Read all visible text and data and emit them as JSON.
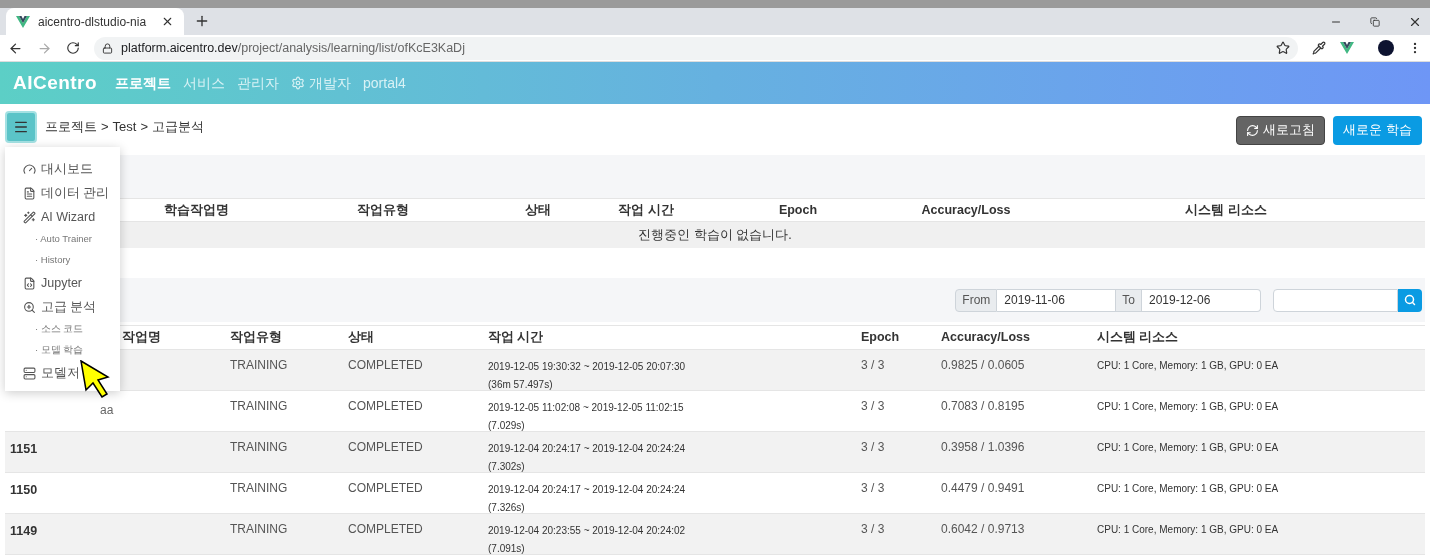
{
  "browser": {
    "tab_title": "aicentro-dlstudio-nia",
    "url_host": "platform.aicentro.dev",
    "url_path": "/project/analysis/learning/list/ofKcE3KaDj"
  },
  "navbar": {
    "brand": "AICentro",
    "items": [
      {
        "label": "프로젝트",
        "selected": true,
        "has_icon": false
      },
      {
        "label": "서비스",
        "selected": false,
        "has_icon": false
      },
      {
        "label": "관리자",
        "selected": false,
        "has_icon": false
      },
      {
        "label": "개발자",
        "selected": false,
        "has_icon": true
      },
      {
        "label": "portal4",
        "selected": false,
        "has_icon": false
      }
    ]
  },
  "breadcrumb": [
    "프로젝트",
    ">",
    "Test",
    ">",
    "고급분석"
  ],
  "buttons": {
    "refresh": "새로고침",
    "new_training": "새로운 학습"
  },
  "side_menu": [
    {
      "label": "대시보드",
      "kind": "main"
    },
    {
      "label": "데이터 관리",
      "kind": "main"
    },
    {
      "label": "AI Wizard",
      "kind": "main"
    },
    {
      "label": "· Auto Trainer",
      "kind": "sub"
    },
    {
      "label": "· History",
      "kind": "sub"
    },
    {
      "label": "Jupyter",
      "kind": "main"
    },
    {
      "label": "고급 분석",
      "kind": "main"
    },
    {
      "label": "· 소스 코드",
      "kind": "sub"
    },
    {
      "label": "· 모델 학습",
      "kind": "sub"
    },
    {
      "label": "모델저",
      "kind": "main"
    }
  ],
  "running_table": {
    "columns": [
      "학습작업명",
      "작업유형",
      "상태",
      "작업 시간",
      "Epoch",
      "Accuracy/Loss",
      "시스템 리소스"
    ],
    "empty_message": "진행중인 학습이 없습니다."
  },
  "filter": {
    "from_label": "From",
    "from_value": "2019-11-06",
    "to_label": "To",
    "to_value": "2019-12-06"
  },
  "history_table": {
    "columns": [
      "작업명",
      "작업유형",
      "상태",
      "작업 시간",
      "Epoch",
      "Accuracy/Loss",
      "시스템 리소스"
    ],
    "rows": [
      {
        "type": "TRAINING",
        "status": "COMPLETED",
        "time_range": "2019-12-05 19:30:32 ~ 2019-12-05 20:07:30",
        "duration": "(36m 57.497s)",
        "epoch": "3 / 3",
        "acc_loss": "0.9825 / 0.0605",
        "resources": "CPU: 1 Core, Memory: 1 GB, GPU: 0 EA"
      },
      {
        "name": "aa",
        "type": "TRAINING",
        "status": "COMPLETED",
        "time_range": "2019-12-05 11:02:08 ~ 2019-12-05 11:02:15",
        "duration": "(7.029s)",
        "epoch": "3 / 3",
        "acc_loss": "0.7083 / 0.8195",
        "resources": "CPU: 1 Core, Memory: 1 GB, GPU: 0 EA"
      },
      {
        "id": "1151",
        "type": "TRAINING",
        "status": "COMPLETED",
        "time_range": "2019-12-04 20:24:17 ~ 2019-12-04 20:24:24",
        "duration": "(7.302s)",
        "epoch": "3 / 3",
        "acc_loss": "0.3958 / 1.0396",
        "resources": "CPU: 1 Core, Memory: 1 GB, GPU: 0 EA"
      },
      {
        "id": "1150",
        "type": "TRAINING",
        "status": "COMPLETED",
        "time_range": "2019-12-04 20:24:17 ~ 2019-12-04 20:24:24",
        "duration": "(7.326s)",
        "epoch": "3 / 3",
        "acc_loss": "0.4479 / 0.9491",
        "resources": "CPU: 1 Core, Memory: 1 GB, GPU: 0 EA"
      },
      {
        "id": "1149",
        "type": "TRAINING",
        "status": "COMPLETED",
        "time_range": "2019-12-04 20:23:55 ~ 2019-12-04 20:24:02",
        "duration": "(7.091s)",
        "epoch": "3 / 3",
        "acc_loss": "0.6042 / 0.9713",
        "resources": "CPU: 1 Core, Memory: 1 GB, GPU: 0 EA"
      }
    ]
  }
}
